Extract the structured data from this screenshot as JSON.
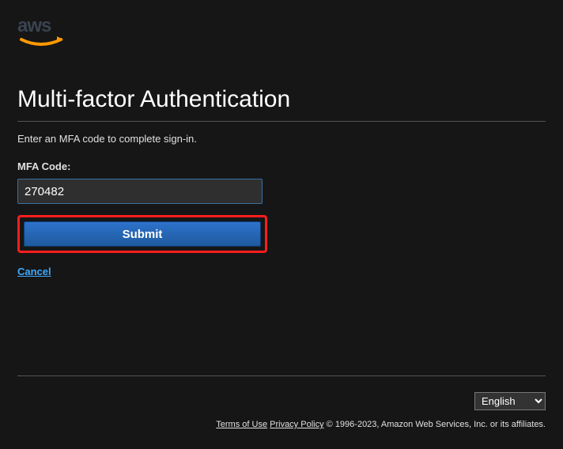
{
  "logo_alt": "aws",
  "page": {
    "title": "Multi-factor Authentication",
    "description": "Enter an MFA code to complete sign-in.",
    "field_label": "MFA Code:",
    "mfa_value": "270482",
    "submit_label": "Submit",
    "cancel_label": "Cancel"
  },
  "footer": {
    "language_selected": "English",
    "terms_label": "Terms of Use",
    "privacy_label": "Privacy Policy",
    "copyright": " © 1996-2023, Amazon Web Services, Inc. or its affiliates."
  }
}
